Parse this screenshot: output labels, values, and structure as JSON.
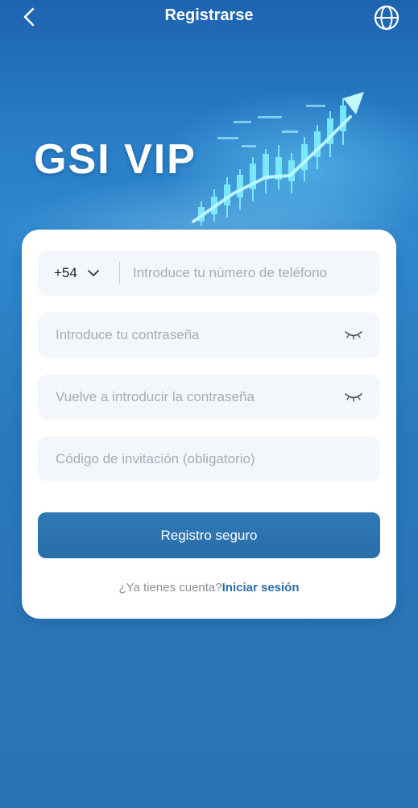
{
  "header": {
    "title": "Registrarse"
  },
  "hero": {
    "brand": "GSI VIP"
  },
  "form": {
    "country_code": "+54",
    "phone_placeholder": "Introduce tu número de teléfono",
    "password_placeholder": "Introduce tu contraseña",
    "confirm_password_placeholder": "Vuelve a introducir la contraseña",
    "invite_placeholder": "Código de invitación (obligatorio)",
    "submit_label": "Registro seguro",
    "have_account_text": "¿Ya tienes cuenta?",
    "login_link_label": "Iniciar sesión"
  },
  "icons": {
    "back": "chevron-left-icon",
    "language": "globe-icon",
    "dropdown": "chevron-down-icon",
    "password_visibility": "eye-closed-icon"
  },
  "colors": {
    "background": "#2a7fc8",
    "primary_button": "#2f78b6",
    "link": "#2b6fae",
    "input_bg": "#f3f6fa"
  }
}
